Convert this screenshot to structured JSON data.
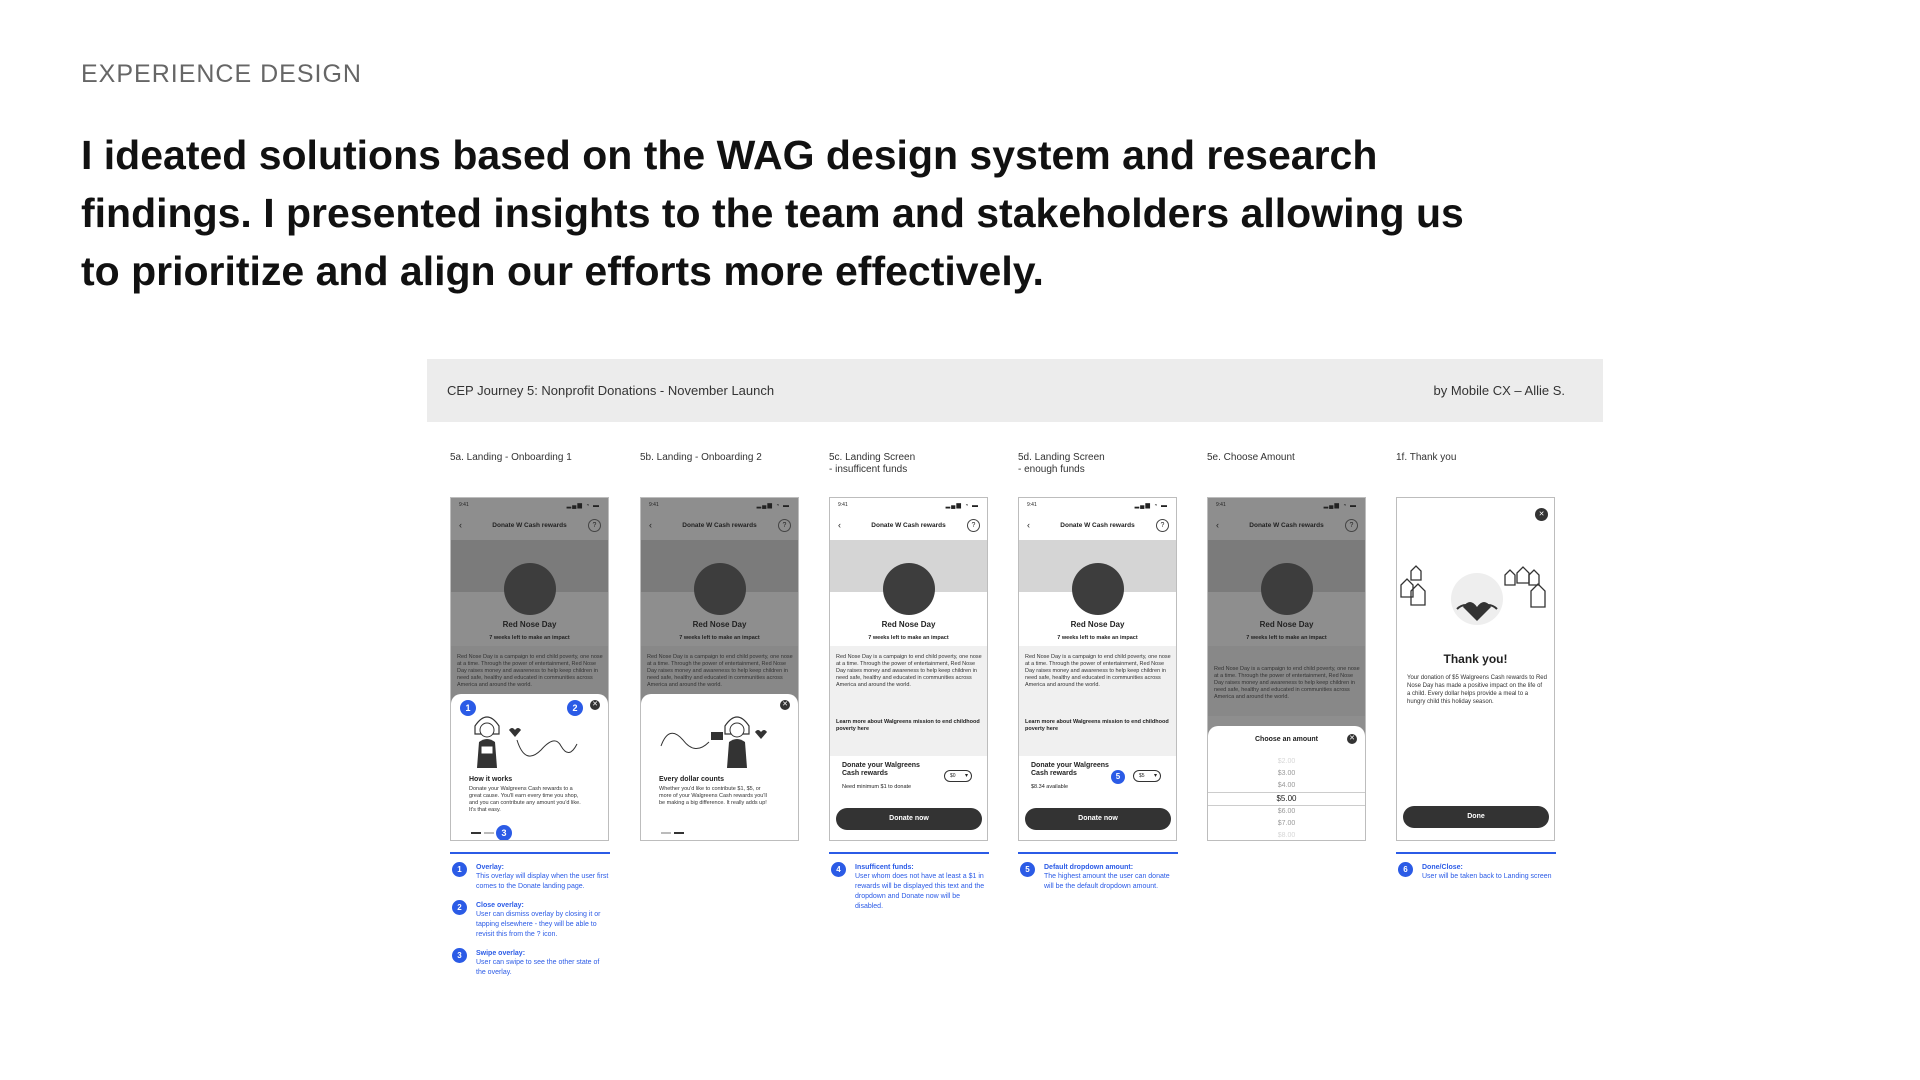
{
  "eyebrow": "EXPERIENCE DESIGN",
  "headline": "I ideated solutions based on the WAG design system and research findings. I presented insights to the team and stakeholders allowing us to prioritize and align our efforts more effectively.",
  "board": {
    "title": "CEP Journey 5: Nonprofit Donations - November Launch",
    "author": "by Mobile CX – Allie S.",
    "frames": [
      {
        "label": "5a. Landing - Onboarding 1"
      },
      {
        "label": "5b. Landing - Onboarding 2"
      },
      {
        "label": "5c. Landing Screen\n- insufficent funds"
      },
      {
        "label": "5d. Landing Screen\n- enough funds"
      },
      {
        "label": "5e. Choose Amount"
      },
      {
        "label": "1f. Thank you"
      }
    ],
    "phone": {
      "time": "9:41",
      "signal": "▂▄▆ ◔ ▬",
      "back": "‹",
      "nav_title": "Donate W Cash rewards",
      "help": "?",
      "org_name": "Red Nose Day",
      "weeks_left": "7 weeks left to make an impact",
      "description": "Red Nose Day is a campaign to end child poverty, one nose at a time. Through the power of entertainment, Red Nose Day raises money and awareness to help keep children in need safe, healthy and educated in communities across America and around the world.",
      "learn_more": "Learn more about Walgreens mission to end childhood poverty here",
      "card_title": "Donate your Walgreens Cash rewards",
      "need_minimum": "Need minimum $1 to donate",
      "available": "$8.34 available",
      "select_zero": "$0",
      "select_five": "$5",
      "donate_cta": "Donate now"
    },
    "onboarding1": {
      "title": "How it works",
      "text": "Donate your Walgreens Cash rewards to a great cause. You'll earn every time you shop, and you can contribute any amount you'd like. It's that easy."
    },
    "onboarding2": {
      "title": "Every dollar counts",
      "text": "Whether you'd like to contribute $1, $5, or more of your Walgreens Cash rewards you'll be making a big difference. It really adds up!"
    },
    "picker": {
      "title": "Choose an amount",
      "options": [
        "$2.00",
        "$3.00",
        "$4.00",
        "$5.00",
        "$6.00",
        "$7.00",
        "$8.00"
      ],
      "selected": "$5.00"
    },
    "thank_you": {
      "title": "Thank you!",
      "text": "Your donation of $5 Walgreens Cash rewards to Red Nose Day has made a positive impact on the life of a child. Every dollar helps provide a meal to a hungry child this holiday season.",
      "done": "Done"
    },
    "badges": [
      "1",
      "2",
      "3",
      "4",
      "5",
      "6"
    ],
    "notes": {
      "n1": {
        "num": "1",
        "title": "Overlay:",
        "text": "This overlay will display when the user first comes to the Donate landing page."
      },
      "n2": {
        "num": "2",
        "title": "Close overlay:",
        "text": "User can dismiss overlay by closing it or tapping elsewhere - they will be able to revisit this from the ? icon."
      },
      "n3": {
        "num": "3",
        "title": "Swipe overlay:",
        "text": "User can swipe to see the other state of the overlay."
      },
      "n4": {
        "num": "4",
        "title": "Insufficent funds:",
        "text": "User whom does not have at least a $1 in rewards will be displayed this text and the dropdown and Donate now will be disabled."
      },
      "n5": {
        "num": "5",
        "title": "Default dropdown amount:",
        "text": "The highest amount the user can donate will be the default dropdown amount."
      },
      "n6": {
        "num": "6",
        "title": "Done/Close:",
        "text": "User will be taken back to Landing screen"
      }
    }
  },
  "colors": {
    "accent": "#2b5be6",
    "dark": "#333333",
    "overlay": "#8e8e8e"
  },
  "icons": [
    "back-chevron-icon",
    "help-icon",
    "close-icon",
    "heart-icon",
    "house-icon"
  ]
}
